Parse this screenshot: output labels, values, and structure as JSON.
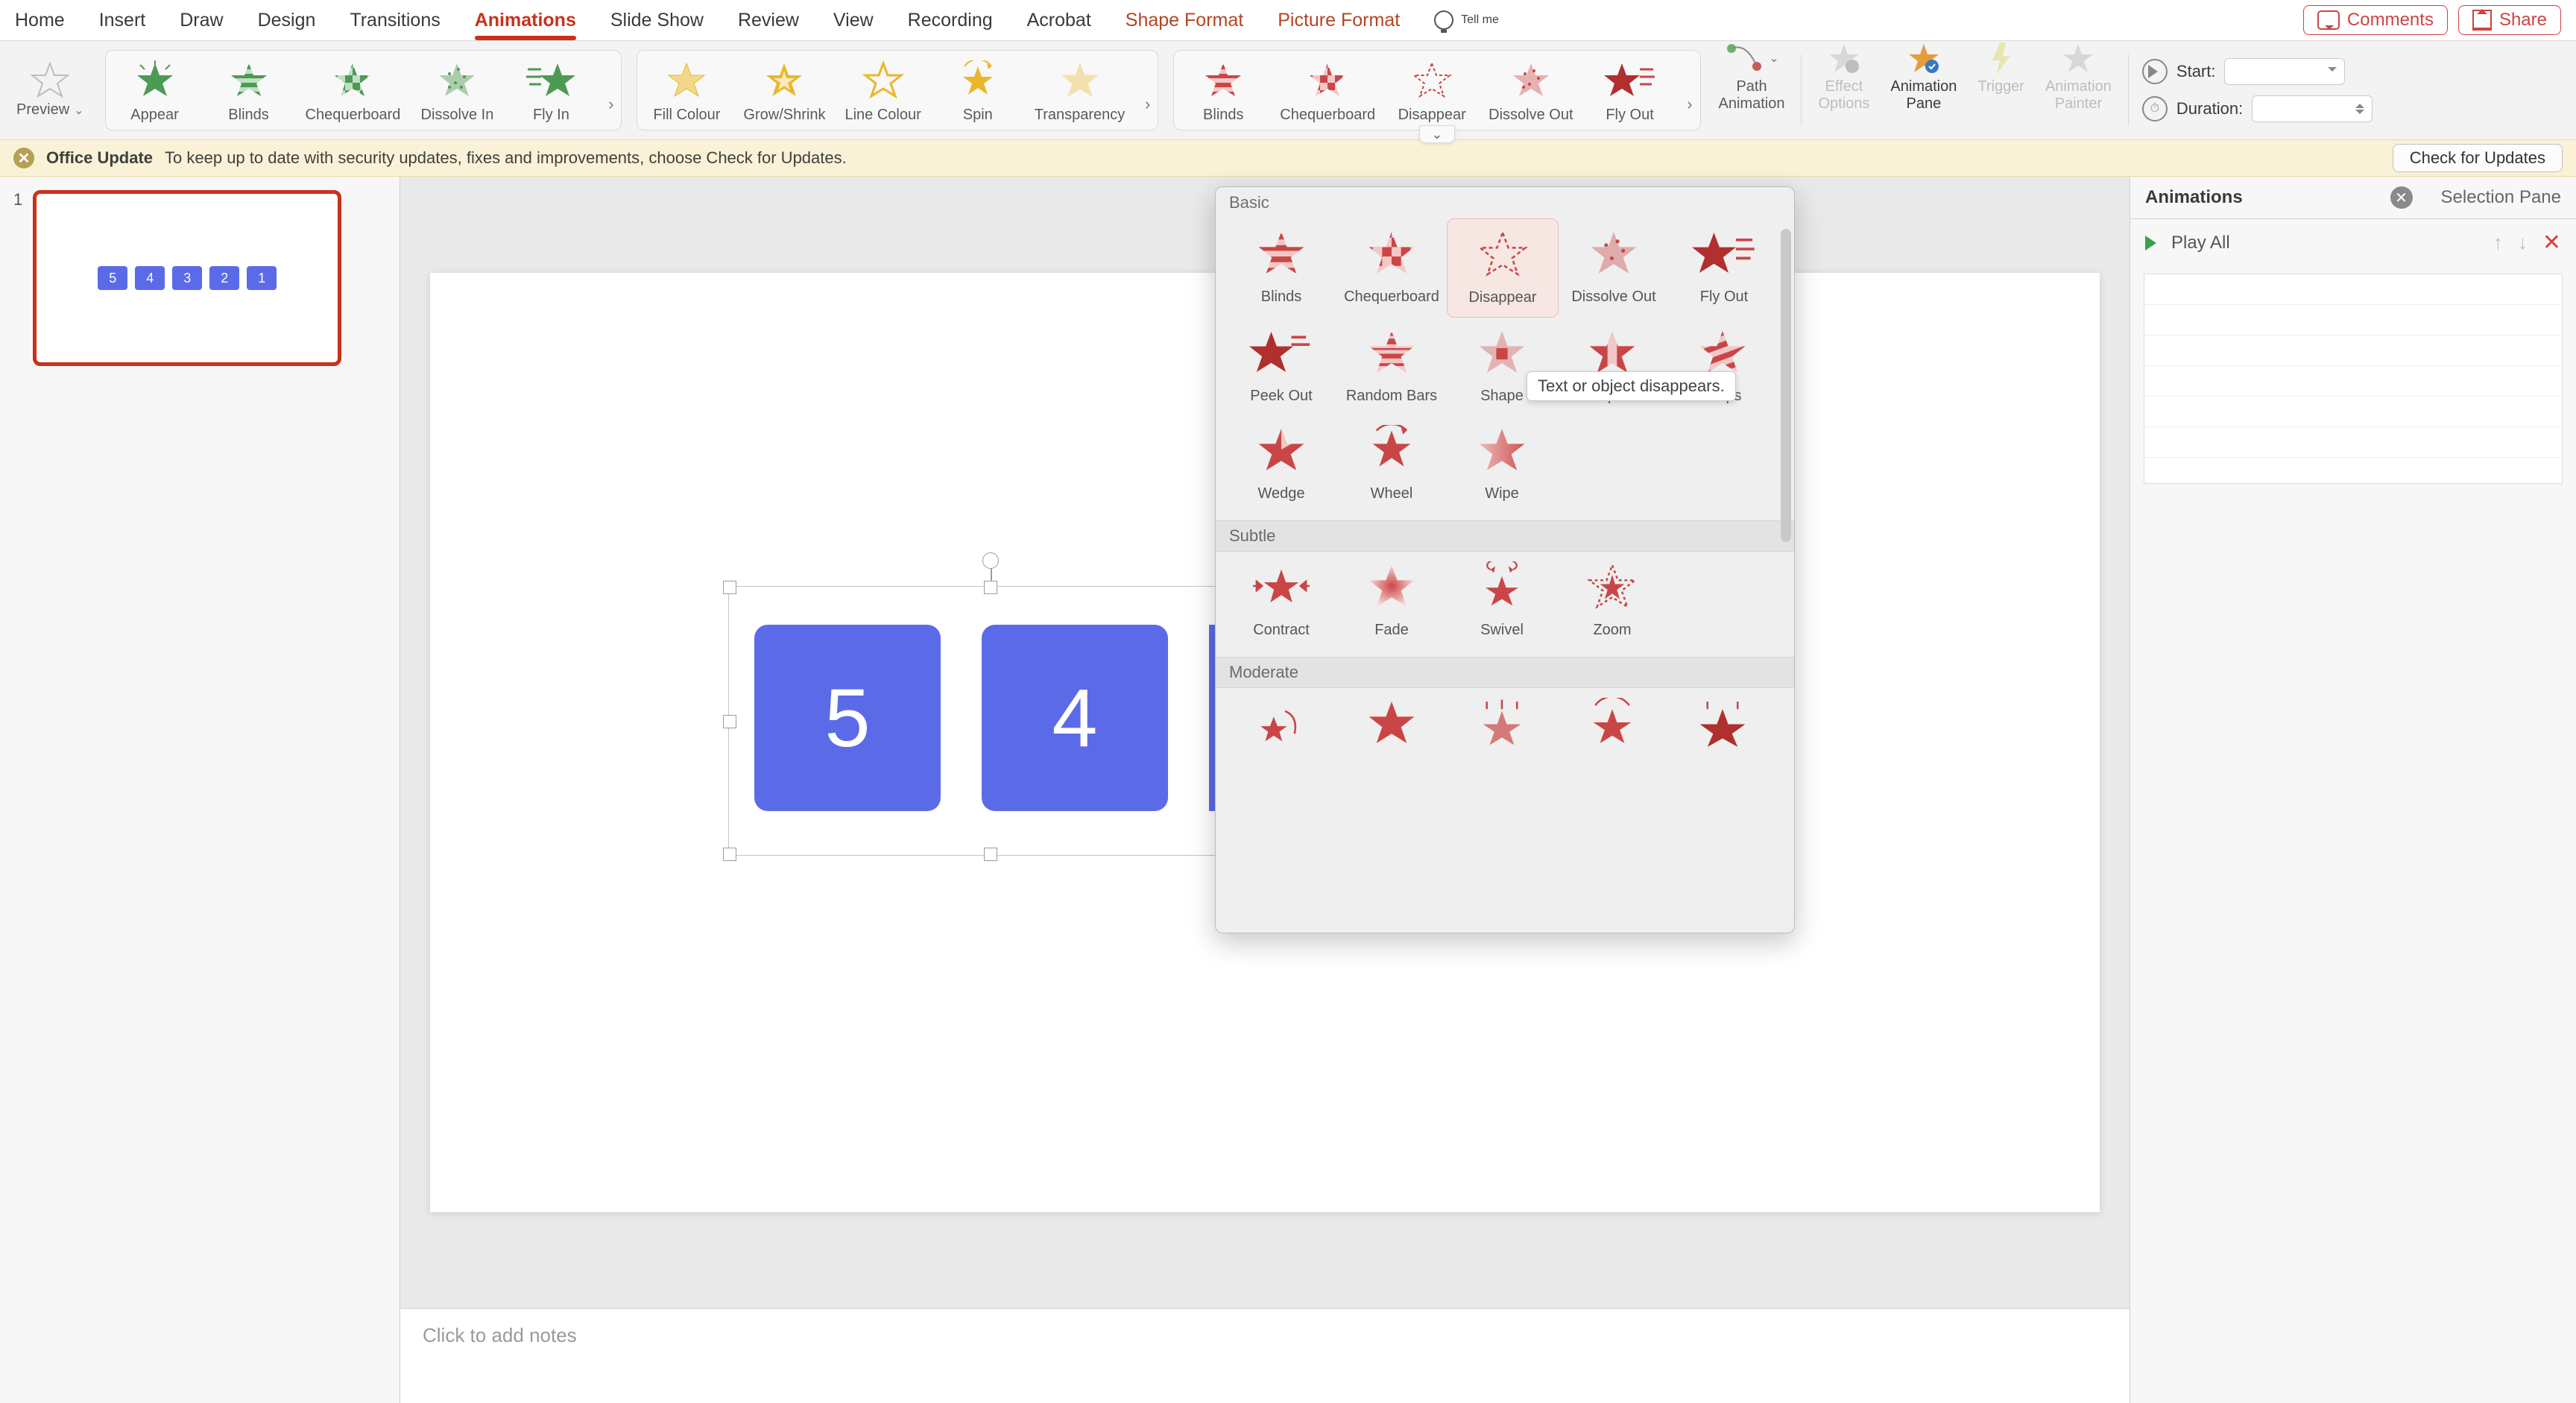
{
  "tabs": {
    "home": "Home",
    "insert": "Insert",
    "draw": "Draw",
    "design": "Design",
    "transitions": "Transitions",
    "animations": "Animations",
    "slide_show": "Slide Show",
    "review": "Review",
    "view": "View",
    "recording": "Recording",
    "acrobat": "Acrobat",
    "shape_format": "Shape Format",
    "picture_format": "Picture Format",
    "tell_me": "Tell me"
  },
  "top_right": {
    "comments": "Comments",
    "share": "Share"
  },
  "ribbon": {
    "preview": "Preview",
    "entrance": [
      "Appear",
      "Blinds",
      "Chequerboard",
      "Dissolve In",
      "Fly In"
    ],
    "emphasis": [
      "Fill Colour",
      "Grow/Shrink",
      "Line Colour",
      "Spin",
      "Transparency"
    ],
    "exit": [
      "Blinds",
      "Chequerboard",
      "Disappear",
      "Dissolve Out",
      "Fly Out"
    ],
    "path": "Path\nAnimation",
    "effect_options": "Effect\nOptions",
    "animation_pane": "Animation\nPane",
    "trigger": "Trigger",
    "painter": "Animation\nPainter",
    "start": "Start:",
    "duration": "Duration:"
  },
  "update_bar": {
    "title": "Office Update",
    "msg": "To keep up to date with security updates, fixes and improvements, choose Check for Updates.",
    "btn": "Check for Updates"
  },
  "thumbnail": {
    "number": "1",
    "boxes": [
      "5",
      "4",
      "3",
      "2",
      "1"
    ]
  },
  "slide": {
    "boxes": [
      "5",
      "4"
    ]
  },
  "notes": "Click to add notes",
  "panes": {
    "animations": "Animations",
    "selection": "Selection Pane",
    "play_all": "Play All"
  },
  "popover": {
    "basic_header": "Basic",
    "basic": [
      "Blinds",
      "Chequerboard",
      "Disappear",
      "Dissolve Out",
      "Fly Out",
      "Peek Out",
      "Random Bars",
      "Shape",
      "Split",
      "Strips",
      "Wedge",
      "Wheel",
      "Wipe"
    ],
    "subtle_header": "Subtle",
    "subtle": [
      "Contract",
      "Fade",
      "Swivel",
      "Zoom"
    ],
    "moderate_header": "Moderate",
    "tooltip": "Text or object disappears."
  }
}
